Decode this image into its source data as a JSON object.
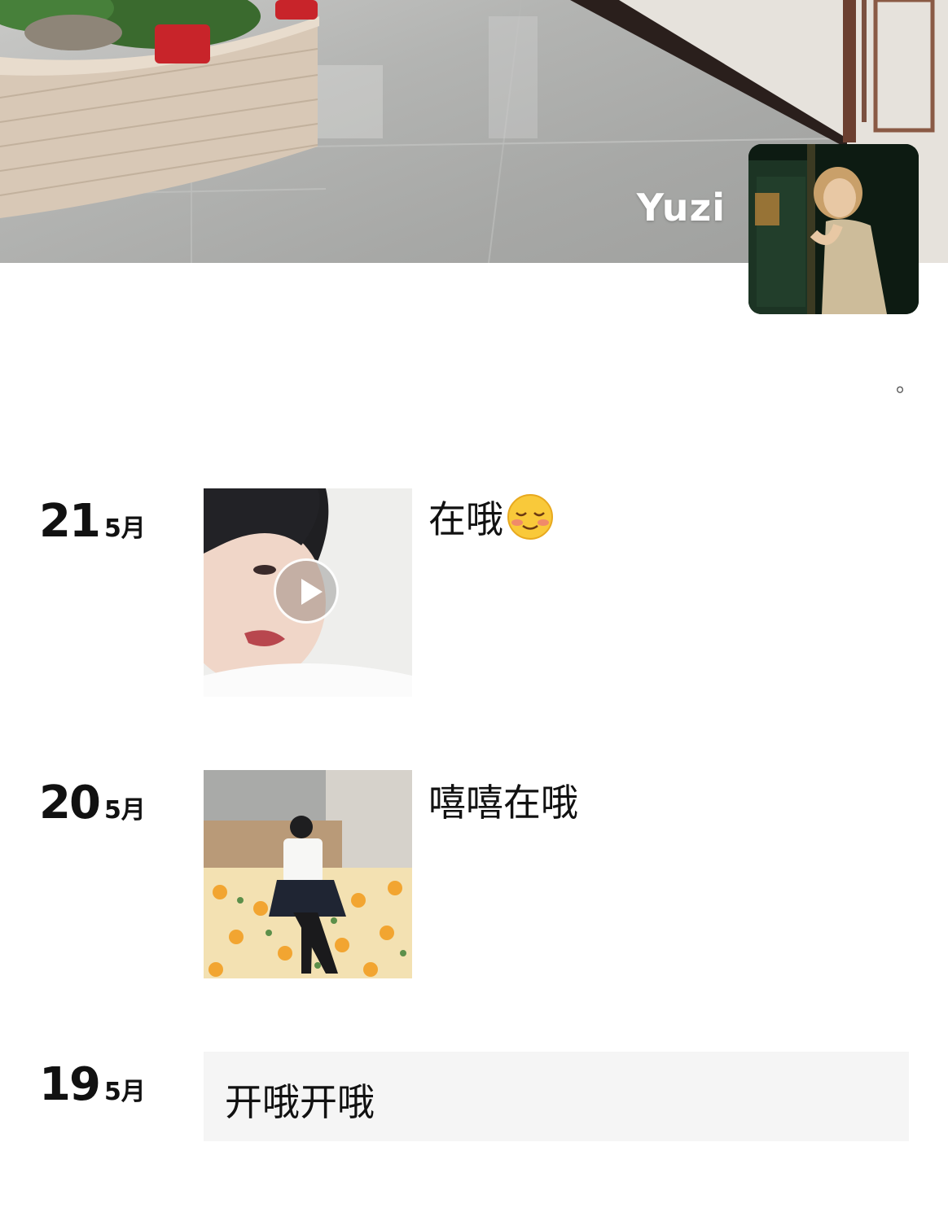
{
  "profile": {
    "name": "Yuzi",
    "signature": "。",
    "cover_image": "lobby-floor-with-planter-photo",
    "avatar_image": "woman-in-dark-doorway-photo"
  },
  "posts": [
    {
      "day": "21",
      "month": "5月",
      "media": "video-thumbnail-short-hair-woman",
      "has_video": true,
      "caption": "在哦",
      "emoji": "blushing-smile-emoji"
    },
    {
      "day": "20",
      "month": "5月",
      "media": "photo-woman-on-flowered-bed",
      "has_video": false,
      "caption": "嘻嘻在哦"
    },
    {
      "day": "19",
      "month": "5月",
      "caption": "开哦开哦"
    }
  ]
}
